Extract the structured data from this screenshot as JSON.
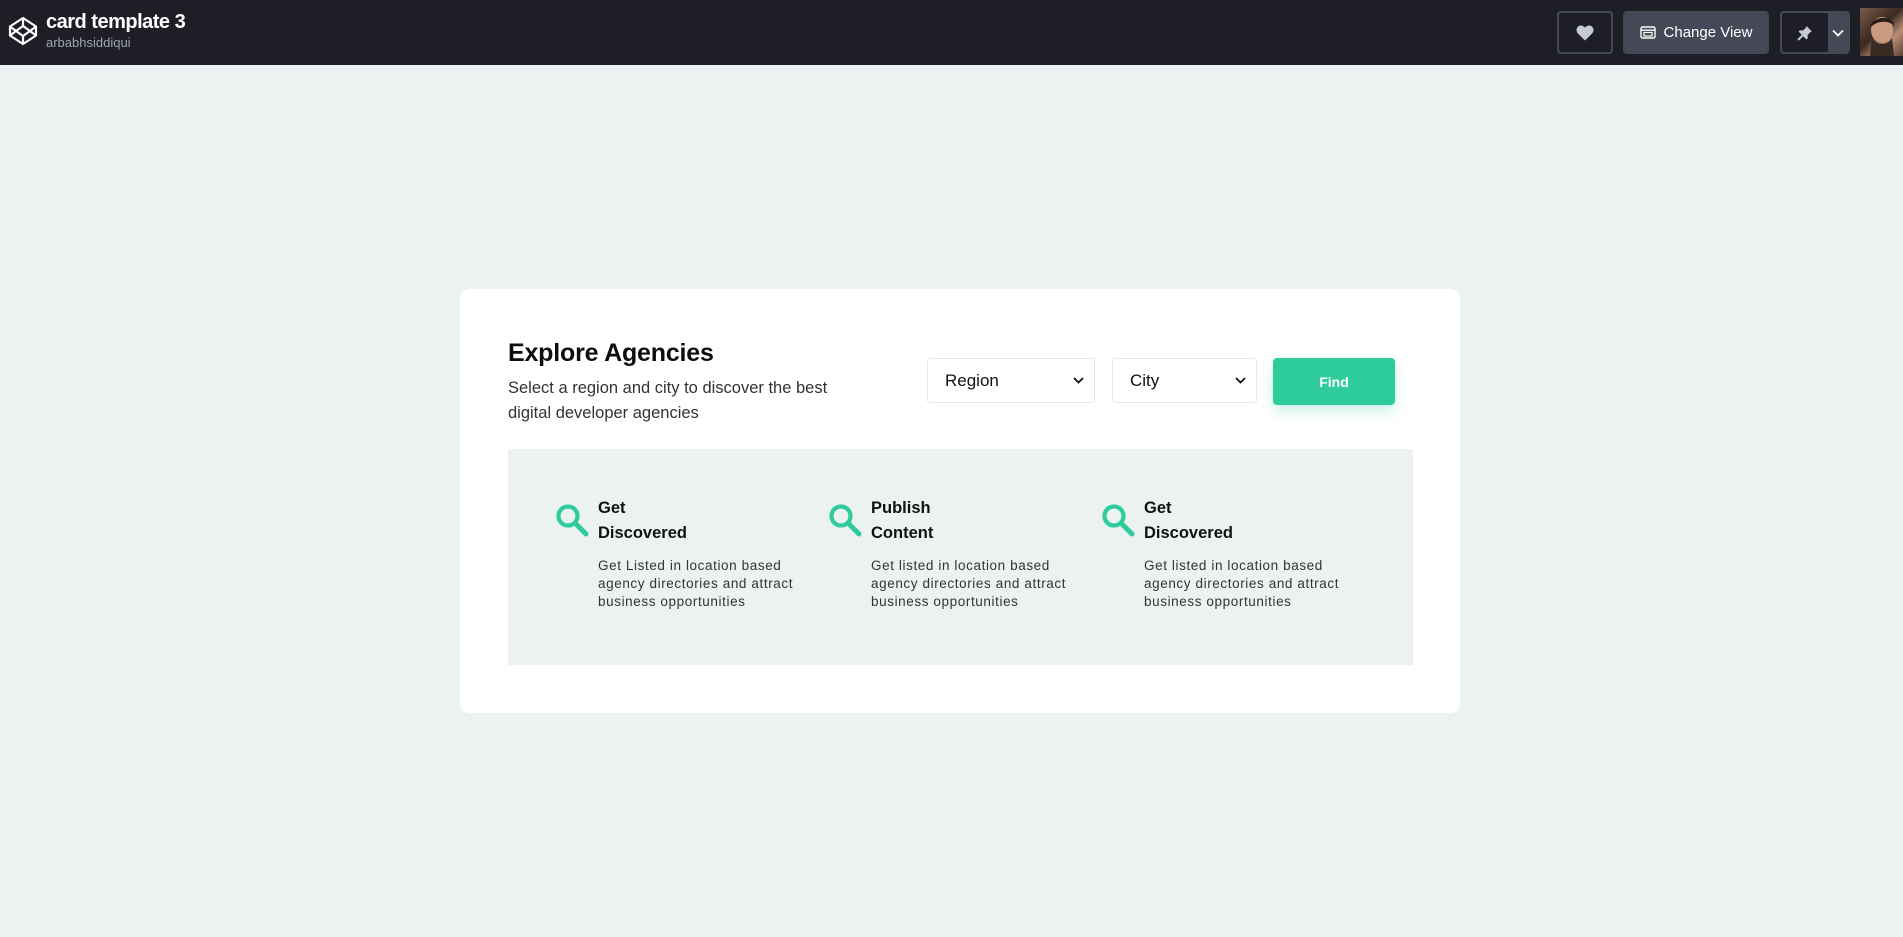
{
  "topbar": {
    "title": "card template 3",
    "author": "arbabhsiddiqui",
    "change_view_label": "Change View"
  },
  "card": {
    "heading": "Explore Agencies",
    "subtext": "Select a region and city to discover the best digital developer agencies",
    "region_select": "Region",
    "city_select": "City",
    "find_label": "Find"
  },
  "features": [
    {
      "title": "Get Discovered",
      "desc": "Get Listed in location based agency directories and attract business opportunities"
    },
    {
      "title": "Publish Content",
      "desc": "Get listed in location based agency directories and attract business opportunities"
    },
    {
      "title": "Get Discovered",
      "desc": "Get listed in location based agency directories and attract business opportunities"
    }
  ],
  "colors": {
    "accent": "#2ecc9a",
    "topbar_bg": "#1e1f26",
    "page_bg": "#ecf2f1"
  },
  "icons": {
    "logo": "codepen-logo-icon",
    "like": "heart-icon",
    "view": "layout-icon",
    "pin": "pin-icon",
    "dropdown": "chevron-down-icon",
    "feature": "search-icon"
  }
}
